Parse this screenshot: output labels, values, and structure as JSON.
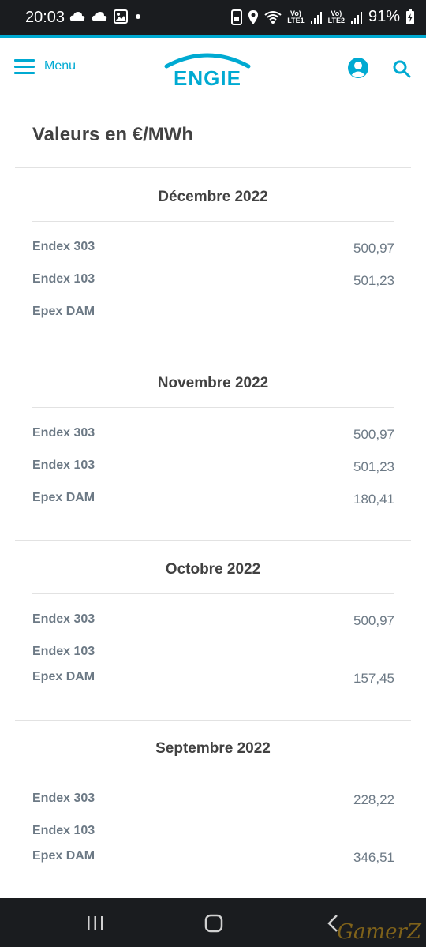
{
  "status_bar": {
    "time": "20:03",
    "lte1": "LTE1",
    "lte2": "LTE2",
    "volte": "Vo)",
    "battery": "91%",
    "icons_left": [
      "cloud-icon",
      "cloud-icon",
      "image-icon",
      "dot-icon"
    ],
    "icons_right": [
      "notification-lock-icon",
      "location-icon",
      "wifi-icon",
      "signal-icon",
      "signal-icon",
      "battery-icon"
    ]
  },
  "header": {
    "menu_label": "Menu",
    "logo_text": "ENGIE",
    "accent_color": "#00aad2"
  },
  "page": {
    "title": "Valeurs en €/MWh"
  },
  "months": [
    {
      "title": "Décembre 2022",
      "rows": [
        {
          "label": "Endex 303",
          "value": "500,97"
        },
        {
          "label": "Endex 103",
          "value": "501,23"
        },
        {
          "label": "Epex DAM",
          "value": ""
        }
      ]
    },
    {
      "title": "Novembre 2022",
      "rows": [
        {
          "label": "Endex 303",
          "value": "500,97"
        },
        {
          "label": "Endex 103",
          "value": "501,23"
        },
        {
          "label": "Epex DAM",
          "value": "180,41"
        }
      ]
    },
    {
      "title": "Octobre 2022",
      "rows": [
        {
          "label": "Endex 303",
          "value": "500,97"
        },
        {
          "label": "Endex 103",
          "value": ""
        },
        {
          "label": "Epex DAM",
          "value": "157,45"
        }
      ]
    },
    {
      "title": "Septembre 2022",
      "rows": [
        {
          "label": "Endex 303",
          "value": "228,22"
        },
        {
          "label": "Endex 103",
          "value": ""
        },
        {
          "label": "Epex DAM",
          "value": "346,51"
        }
      ]
    }
  ],
  "nav_bar": {
    "watermark": "GamerZ"
  }
}
